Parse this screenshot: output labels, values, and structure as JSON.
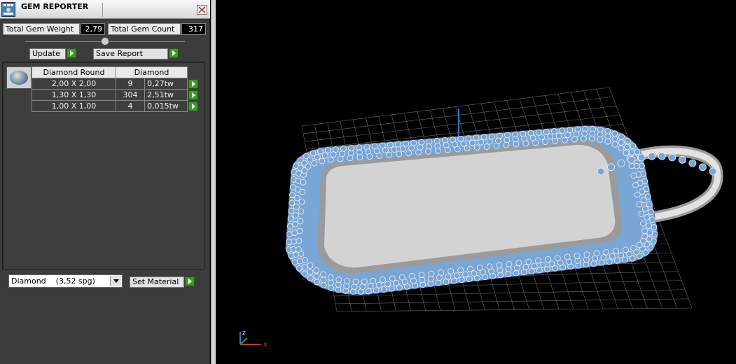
{
  "window": {
    "title": "GEM REPORTER"
  },
  "stats": {
    "weight_label": "Total Gem Weight",
    "weight_value": "2,79",
    "count_label": "Total Gem Count",
    "count_value": "317"
  },
  "toolbar": {
    "update_label": "Update",
    "save_label": "Save Report"
  },
  "table": {
    "headers": [
      "Diamond Round",
      "Diamond"
    ],
    "rows": [
      {
        "size": "2,00 X 2,00",
        "count": "9",
        "weight": "0,27tw"
      },
      {
        "size": "1,30 X 1,30",
        "count": "304",
        "weight": "2,51tw"
      },
      {
        "size": "1,00 X 1,00",
        "count": "4",
        "weight": "0,015tw"
      }
    ]
  },
  "material": {
    "selected": "Diamond    (3,52 spg)",
    "set_label": "Set Material"
  },
  "viewport": {
    "axis_x_label": "x",
    "axis_z_label": "z",
    "colors": {
      "gem": "#7aa6d6",
      "metal": "#cfcfcf",
      "grid": "#6a6a6a",
      "axis_x": "#c0392b",
      "axis_z": "#2a7ab8"
    }
  },
  "accent_colors": {
    "go_button": "#3a9d23"
  }
}
